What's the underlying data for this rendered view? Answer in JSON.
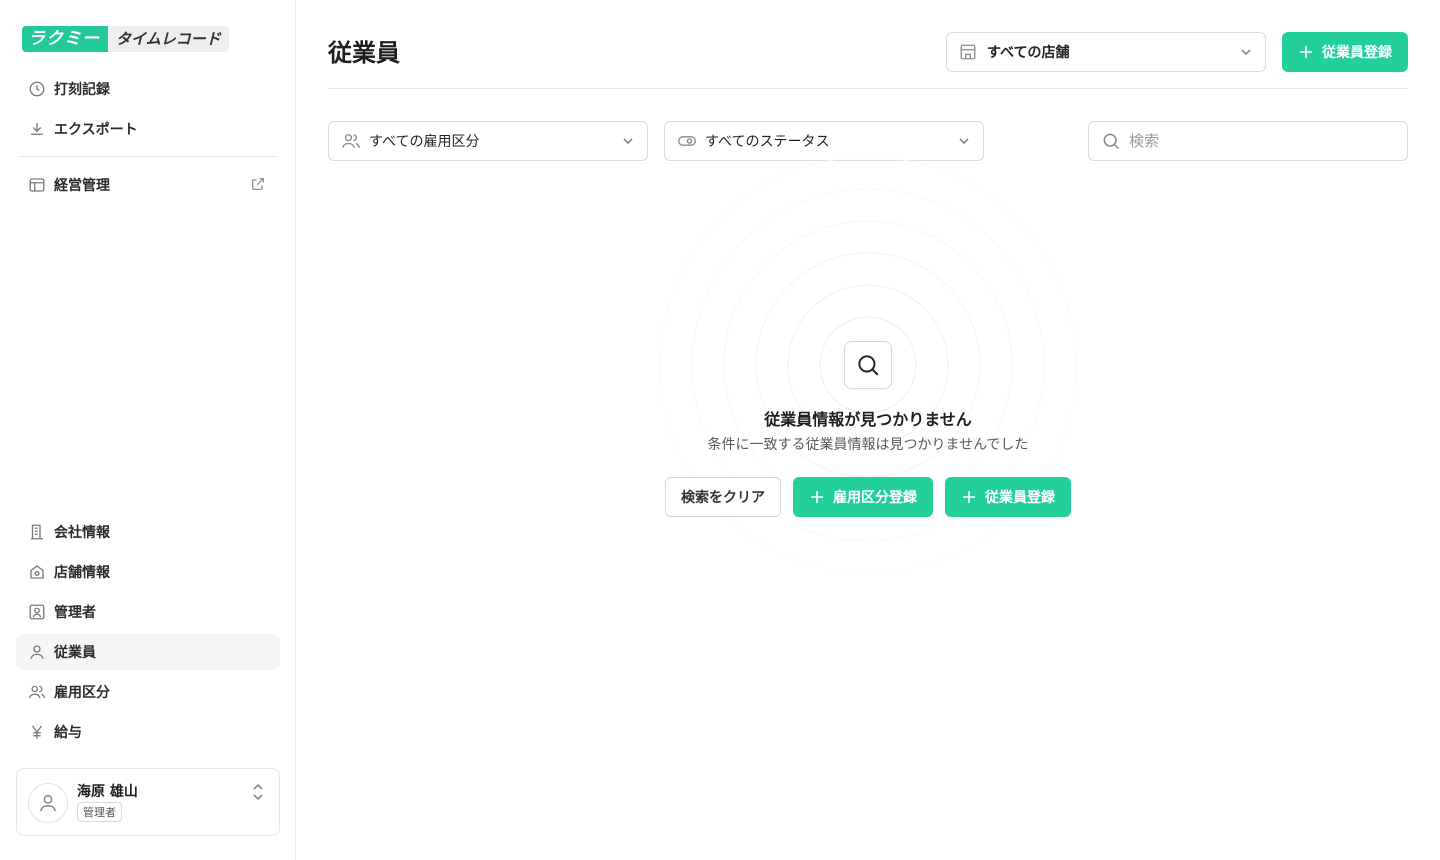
{
  "logo": {
    "primary": "ラクミー",
    "secondary": "タイムレコード"
  },
  "sidebar": {
    "top_items": [
      {
        "label": "打刻記録",
        "icon": "clock-icon"
      },
      {
        "label": "エクスポート",
        "icon": "download-icon"
      }
    ],
    "management": {
      "label": "経営管理",
      "icon": "layout-icon",
      "external_icon": "external-link-icon"
    },
    "bottom_items": [
      {
        "label": "会社情報",
        "icon": "building-icon"
      },
      {
        "label": "店舗情報",
        "icon": "store-icon"
      },
      {
        "label": "管理者",
        "icon": "admin-icon"
      },
      {
        "label": "従業員",
        "icon": "user-icon",
        "active": true
      },
      {
        "label": "雇用区分",
        "icon": "users-icon"
      },
      {
        "label": "給与",
        "icon": "yen-icon"
      }
    ],
    "user": {
      "name": "海原 雄山",
      "role": "管理者"
    }
  },
  "header": {
    "title": "従業員",
    "store_select": "すべての店舗",
    "add_button": "従業員登録"
  },
  "filters": {
    "employment": "すべての雇用区分",
    "status": "すべてのステータス",
    "search_placeholder": "検索",
    "search_value": ""
  },
  "empty_state": {
    "title": "従業員情報が見つかりません",
    "subtitle": "条件に一致する従業員情報は見つかりませんでした",
    "clear_button": "検索をクリア",
    "add_employment_button": "雇用区分登録",
    "add_employee_button": "従業員登録"
  },
  "colors": {
    "accent": "#23cf9b",
    "border": "#dcdcdc",
    "active_bg": "#f5f5f5"
  }
}
